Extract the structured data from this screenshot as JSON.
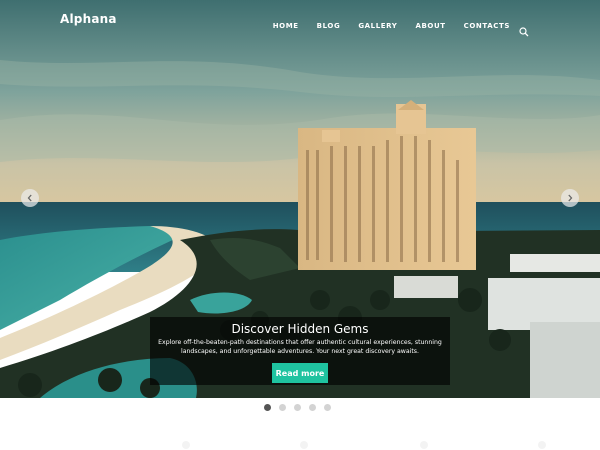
{
  "site": {
    "logo": "Alphana"
  },
  "nav": {
    "items": [
      {
        "label": "HOME"
      },
      {
        "label": "BLOG"
      },
      {
        "label": "GALLERY"
      },
      {
        "label": "ABOUT"
      },
      {
        "label": "CONTACTS"
      }
    ],
    "search_icon": "search-icon"
  },
  "slider": {
    "prev_icon": "chevron-left-icon",
    "next_icon": "chevron-right-icon",
    "slide": {
      "title": "Discover Hidden Gems",
      "text": "Explore off-the-beaten-path destinations that offer authentic cultural experiences, stunning landscapes, and unforgettable adventures. Your next great discovery awaits.",
      "button_label": "Read more"
    },
    "dots": 5,
    "active_dot": 0
  },
  "colors": {
    "accent": "#1fc3a0",
    "active_dot": "#555555",
    "inactive_dot": "#d3d3d3"
  }
}
